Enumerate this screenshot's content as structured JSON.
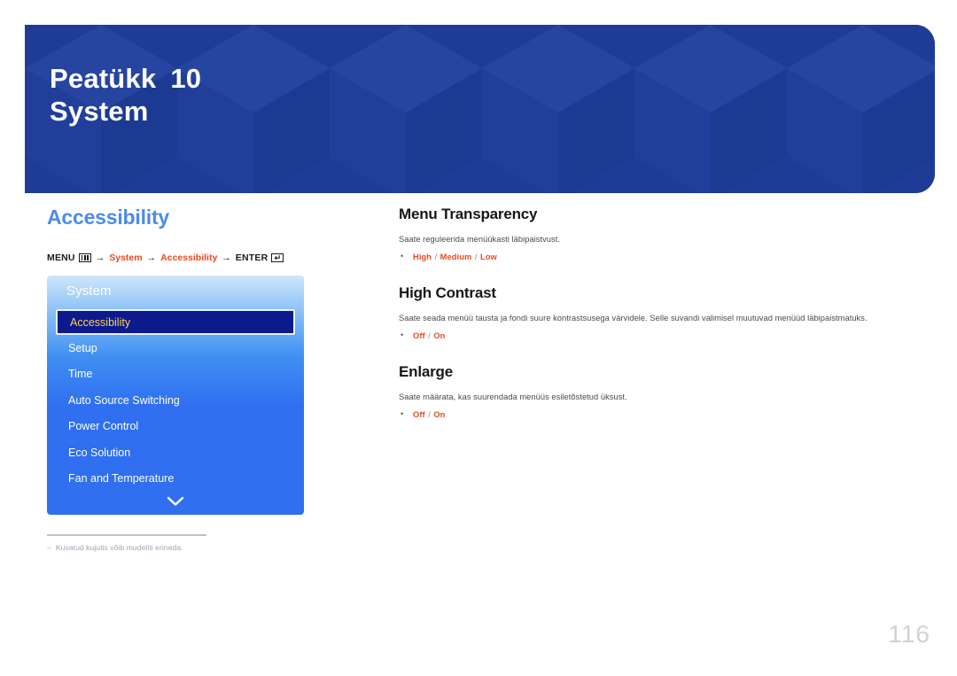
{
  "header": {
    "chapter_label": "Peatükk",
    "chapter_number": "10",
    "chapter_title": "System",
    "background_color": "#1e3d96"
  },
  "left": {
    "section_title": "Accessibility",
    "section_title_color": "#4a8ceb",
    "breadcrumb": {
      "menu_label": "MENU",
      "menu_icon": "menu-bars-icon",
      "arrow": "→",
      "step1": "System",
      "step2": "Accessibility",
      "enter_label": "ENTER",
      "enter_icon": "enter-return-icon",
      "highlight_color": "#e8491f"
    },
    "osd": {
      "title": "System",
      "items": [
        {
          "label": "Accessibility",
          "selected": true
        },
        {
          "label": "Setup",
          "selected": false
        },
        {
          "label": "Time",
          "selected": false
        },
        {
          "label": "Auto Source Switching",
          "selected": false
        },
        {
          "label": "Power Control",
          "selected": false
        },
        {
          "label": "Eco Solution",
          "selected": false
        },
        {
          "label": "Fan and Temperature",
          "selected": false
        }
      ],
      "more_indicator": "chevron-down-icon",
      "selected_text_color": "#ffd24a",
      "selected_bg_color": "#0c1a8e"
    },
    "footnote": {
      "marker": "–",
      "text": "Kuvatud kujutis võib mudeliti erineda."
    }
  },
  "right": {
    "topics": [
      {
        "heading": "Menu Transparency",
        "description": "Saate reguleerida menüükasti läbipaistvust.",
        "options": [
          "High",
          "Medium",
          "Low"
        ],
        "separator": "/"
      },
      {
        "heading": "High Contrast",
        "description": "Saate seada menüü tausta ja fondi suure kontrastsusega värvidele. Selle suvandi valimisel muutuvad menüüd läbipaistmatuks.",
        "options": [
          "Off",
          "On"
        ],
        "separator": "/"
      },
      {
        "heading": "Enlarge",
        "description": "Saate määrata, kas suurendada menüüs esiletõstetud üksust.",
        "options": [
          "Off",
          "On"
        ],
        "separator": "/"
      }
    ]
  },
  "page_number": "116"
}
